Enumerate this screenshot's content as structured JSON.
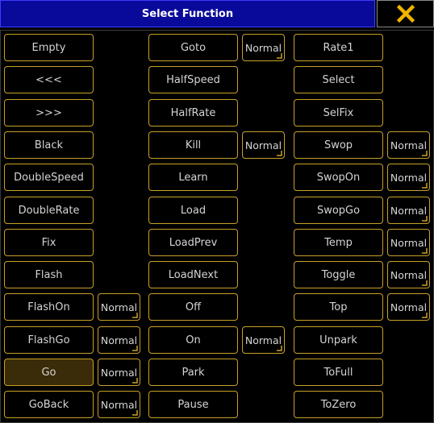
{
  "window": {
    "title": "Select Function",
    "close_icon": "close-x-icon"
  },
  "colors": {
    "title_bg": "#0a0a9a",
    "accent": "#c8a028",
    "close_x": "#f0b400",
    "selected_bg": "#3a2c08"
  },
  "columns": [
    [
      {
        "label": "Empty"
      },
      {
        "label": "<<<"
      },
      {
        "label": ">>>"
      },
      {
        "label": "Black"
      },
      {
        "label": "DoubleSpeed"
      },
      {
        "label": "DoubleRate"
      },
      {
        "label": "Fix"
      },
      {
        "label": "Flash"
      },
      {
        "label": "FlashOn",
        "mode": "Normal"
      },
      {
        "label": "FlashGo",
        "mode": "Normal"
      },
      {
        "label": "Go",
        "mode": "Normal",
        "selected": true
      },
      {
        "label": "GoBack",
        "mode": "Normal"
      }
    ],
    [
      {
        "label": "Goto",
        "mode": "Normal"
      },
      {
        "label": "HalfSpeed"
      },
      {
        "label": "HalfRate"
      },
      {
        "label": "Kill",
        "mode": "Normal"
      },
      {
        "label": "Learn"
      },
      {
        "label": "Load"
      },
      {
        "label": "LoadPrev"
      },
      {
        "label": "LoadNext"
      },
      {
        "label": "Off"
      },
      {
        "label": "On",
        "mode": "Normal"
      },
      {
        "label": "Park"
      },
      {
        "label": "Pause"
      }
    ],
    [
      {
        "label": "Rate1"
      },
      {
        "label": "Select"
      },
      {
        "label": "SelFix"
      },
      {
        "label": "Swop",
        "mode": "Normal"
      },
      {
        "label": "SwopOn",
        "mode": "Normal"
      },
      {
        "label": "SwopGo",
        "mode": "Normal"
      },
      {
        "label": "Temp",
        "mode": "Normal"
      },
      {
        "label": "Toggle",
        "mode": "Normal"
      },
      {
        "label": "Top",
        "mode": "Normal"
      },
      {
        "label": "Unpark"
      },
      {
        "label": "ToFull"
      },
      {
        "label": "ToZero"
      }
    ]
  ]
}
